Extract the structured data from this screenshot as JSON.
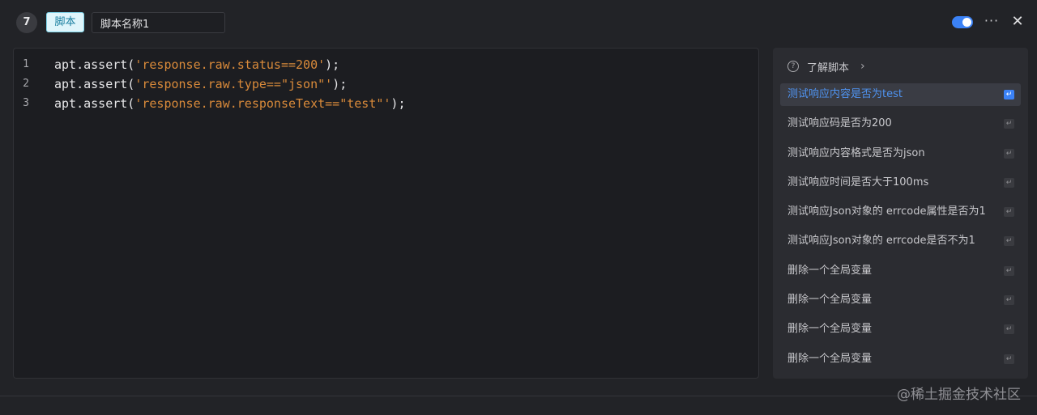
{
  "header": {
    "step_number": "7",
    "type_tag": "脚本",
    "script_name": "脚本名称1",
    "toggle_on": true,
    "more_label": "···",
    "close_label": "✕"
  },
  "editor": {
    "lines": [
      {
        "no": "1",
        "pre": "apt.assert(",
        "str": "'response.raw.status==200'",
        "post": ");"
      },
      {
        "no": "2",
        "pre": "apt.assert(",
        "str": "'response.raw.type==\"json\"'",
        "post": ");"
      },
      {
        "no": "3",
        "pre": "apt.assert(",
        "str": "'response.raw.responseText==\"test\"'",
        "post": ");"
      }
    ]
  },
  "side": {
    "title": "了解脚本",
    "help_icon": "?",
    "chevron": "›",
    "enter_glyph": "↵",
    "snippets": [
      "测试响应内容是否为test",
      "测试响应码是否为200",
      "测试响应内容格式是否为json",
      "测试响应时间是否大于100ms",
      "测试响应Json对象的 errcode属性是否为1",
      "测试响应Json对象的 errcode是否不为1",
      "删除一个全局变量",
      "删除一个全局变量",
      "删除一个全局变量",
      "删除一个全局变量"
    ],
    "active_index": 0
  },
  "watermark": "@稀土掘金技术社区",
  "colors": {
    "accent": "#3b82f6",
    "string": "#d98a3a",
    "active_text": "#4f93f0"
  }
}
